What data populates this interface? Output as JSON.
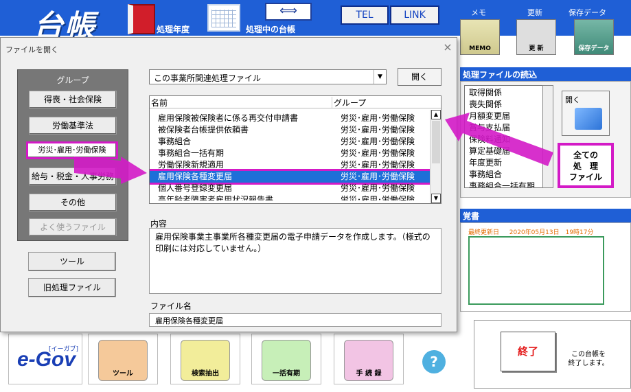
{
  "app": {
    "logo": "台帳",
    "year_label": "処理年度",
    "current_label": "処理中の台帳",
    "arrows": "⟺",
    "tel": "TEL",
    "link": "LINK",
    "memo_label": "メモ",
    "update_label": "更新",
    "save_label": "保存データ",
    "memo_icon_text": "MEMO",
    "update_icon_text": "更 新",
    "save_icon_text": "保存データ"
  },
  "read_panel": {
    "title": "処理ファイルの読込",
    "items": [
      "取得関係",
      "喪失関係",
      "月額変更届",
      "賞与支払届",
      "保険料通知",
      "算定基礎届",
      "年度更新",
      "事務組合",
      "事務組合一括有期"
    ],
    "open_label": "開く",
    "all_files_lines": [
      "全ての",
      "処　理",
      "ファイル"
    ]
  },
  "memo_panel": {
    "title": "覚書",
    "last_update_label": "最終更新日",
    "last_update_value": "2020年05月13日　19時17分"
  },
  "exit": {
    "label": "終了",
    "note_lines": [
      "この台帳を",
      "終了します。"
    ]
  },
  "bottom": {
    "egov": "e-Gov",
    "egov_sub": "[イーガブ]",
    "tool": "ツール",
    "search": "検索抽出",
    "bulk": "一括有期",
    "procedure": "手 続 録",
    "help": "?"
  },
  "dialog": {
    "title": "ファイルを開く",
    "close": "×",
    "group_heading": "グループ",
    "groups": [
      {
        "label": "得喪・社会保険"
      },
      {
        "label": "労働基準法"
      },
      {
        "label": "労災･雇用･労働保険"
      },
      {
        "label": "給与・税金・人事労務"
      },
      {
        "label": "その他"
      },
      {
        "label": "よく使うファイル"
      }
    ],
    "tool_button": "ツール",
    "old_button": "旧処理ファイル",
    "filter_value": "この事業所関連処理ファイル",
    "open_button": "開く",
    "list_header_name": "名前",
    "list_header_group": "グループ",
    "rows": [
      {
        "name": "雇用保険被保険者に係る再交付申請書",
        "group": "労災･雇用･労働保険"
      },
      {
        "name": "被保険者台帳提供依頼書",
        "group": "労災･雇用･労働保険"
      },
      {
        "name": "事務組合",
        "group": "労災･雇用･労働保険"
      },
      {
        "name": "事務組合一括有期",
        "group": "労災･雇用･労働保険"
      },
      {
        "name": "労働保険新規適用",
        "group": "労災･雇用･労働保険"
      },
      {
        "name": "雇用保険各種変更届",
        "group": "労災･雇用･労働保険"
      },
      {
        "name": "個人番号登録変更届",
        "group": "労災･雇用･労働保険"
      },
      {
        "name": "高年齢者障害者雇用状況報告書",
        "group": "労災･雇用･労働保険"
      }
    ],
    "desc_label": "内容",
    "description": "雇用保険事業主事業所各種変更届の電子申請データを作成します。（様式の印刷には対応していません。）",
    "fname_label": "ファイル名",
    "fname_value": "雇用保険各種変更届"
  },
  "colors": {
    "app_blue": "#1f5fd6",
    "highlight_magenta": "#d31ac6",
    "selection_blue": "#1e6fd8"
  }
}
